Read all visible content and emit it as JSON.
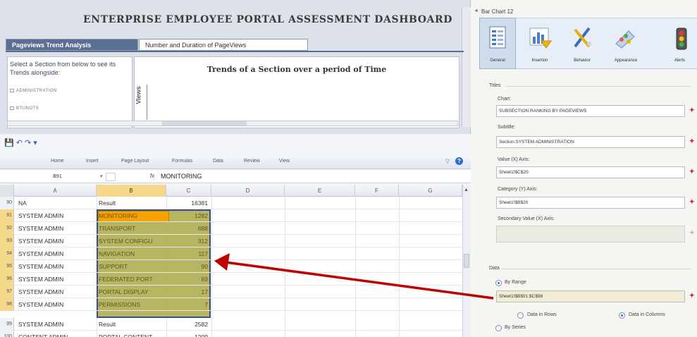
{
  "dashboard": {
    "title": "ENTERPRISE EMPLOYEE PORTAL ASSESSMENT DASHBOARD",
    "tabs": [
      {
        "label": "Pageviews Trend Analysis",
        "active": true
      },
      {
        "label": "Number and Duration of PageViews",
        "active": false
      }
    ],
    "section_prompt": "Select a Section from below to see its Trends alongside:",
    "sections": [
      "ADMINISTRATION",
      "BTUNOTS"
    ],
    "trend_title": "Trends of a Section over a period of Time",
    "y_axis_label": "Views"
  },
  "excel": {
    "ribbon_tabs": [
      "Home",
      "Insert",
      "Page Layout",
      "Formulas",
      "Data",
      "Review",
      "View"
    ],
    "name_box": "B91",
    "fx_label": "fx",
    "formula_value": "MONITORING",
    "columns": [
      "A",
      "B",
      "C",
      "D",
      "E",
      "F",
      "G"
    ],
    "selected_column": "B",
    "rows": [
      {
        "num": "90",
        "a": "NA",
        "b": "Result",
        "c": "16381"
      },
      {
        "num": "91",
        "a": "SYSTEM ADMIN",
        "b": "MONITORING",
        "c": "1282"
      },
      {
        "num": "92",
        "a": "SYSTEM ADMIN",
        "b": "TRANSPORT",
        "c": "688"
      },
      {
        "num": "93",
        "a": "SYSTEM ADMIN",
        "b": "SYSTEM CONFIGU",
        "c": "312"
      },
      {
        "num": "94",
        "a": "SYSTEM ADMIN",
        "b": "NAVIGATION",
        "c": "117"
      },
      {
        "num": "95",
        "a": "SYSTEM ADMIN",
        "b": "SUPPORT",
        "c": "90"
      },
      {
        "num": "96",
        "a": "SYSTEM ADMIN",
        "b": "FEDERATED PORT",
        "c": "69"
      },
      {
        "num": "97",
        "a": "SYSTEM ADMIN",
        "b": "PORTAL DISPLAY",
        "c": "17"
      },
      {
        "num": "98",
        "a": "SYSTEM ADMIN",
        "b": "PERMISSIONS",
        "c": "7"
      },
      {
        "num": "99",
        "a": "SYSTEM ADMIN",
        "b": "Result",
        "c": "2582"
      },
      {
        "num": "100",
        "a": "CONTENT ADMIN",
        "b": "PORTAL CONTENT",
        "c": "1209"
      }
    ]
  },
  "panel": {
    "title": "Bar Chart 12",
    "categories": [
      "General",
      "Insertion",
      "Behavior",
      "Appearance",
      "Alerts"
    ],
    "active_category": "General",
    "titles_header": "Titles",
    "fields": {
      "chart_label": "Chart:",
      "chart_value": "SUBSECTION RANKING BY PAGEVIEWS",
      "subtitle_label": "Subtitle:",
      "subtitle_value": "Section:SYSTEM ADMINISTRATION",
      "value_axis_label": "Value (X) Axis:",
      "value_axis_value": "Sheet1!$C$20",
      "category_axis_label": "Category (Y) Axis:",
      "category_axis_value": "Sheet1!$B$20",
      "secondary_axis_label": "Secondary Value (X) Axis:",
      "secondary_axis_value": ""
    },
    "data_header": "Data",
    "by_range_label": "By Range",
    "range_value": "Sheet1!$B$91:$C$98",
    "data_in_rows_label": "Data in Rows",
    "data_in_columns_label": "Data in Columns",
    "by_series_label": "By Series",
    "data_orientation": "columns"
  },
  "colors": {
    "tab_active": "#5a6f93",
    "selection_fill": "#aaa846",
    "active_cell": "#f7a200",
    "arrow": "#c00000",
    "fx_button": "#c21e5a"
  }
}
